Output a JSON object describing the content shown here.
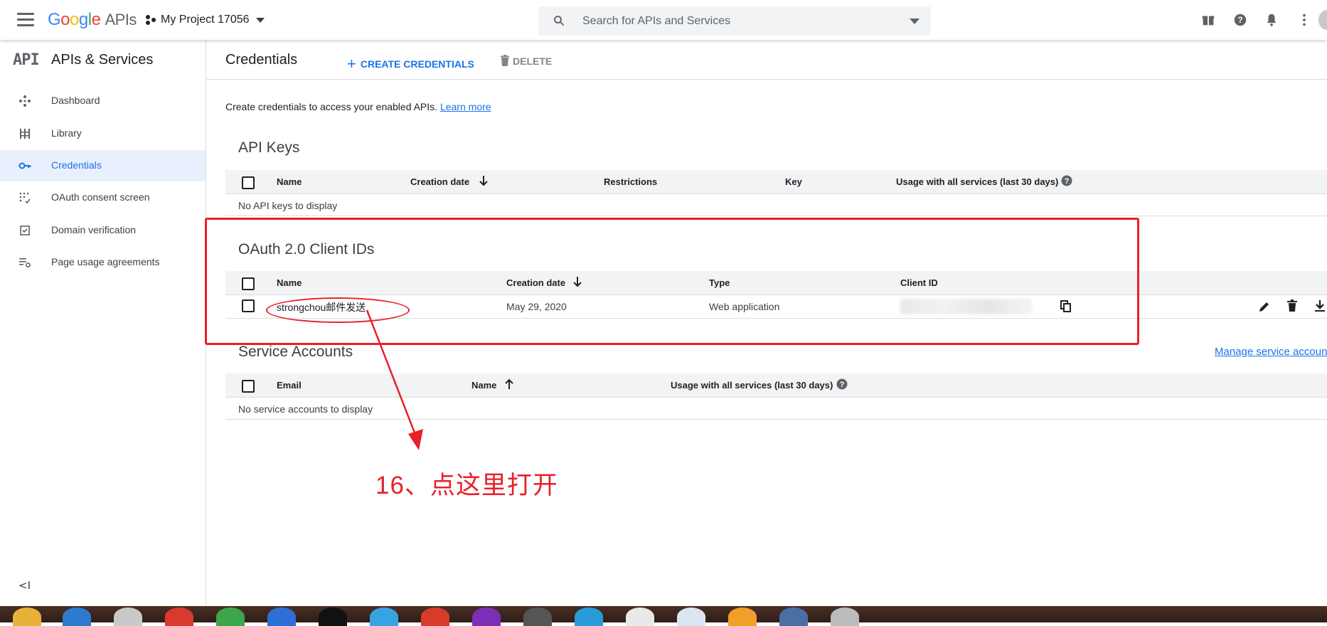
{
  "topbar": {
    "logo_word": "Google",
    "logo_suffix": "APIs",
    "project_name": "My Project 17056",
    "search_placeholder": "Search for APIs and Services"
  },
  "sidebar": {
    "title": "APIs & Services",
    "head_icon_text": "API",
    "items": [
      {
        "label": "Dashboard",
        "icon": "dashboard-icon"
      },
      {
        "label": "Library",
        "icon": "library-icon"
      },
      {
        "label": "Credentials",
        "icon": "key-icon",
        "active": true
      },
      {
        "label": "OAuth consent screen",
        "icon": "consent-icon"
      },
      {
        "label": "Domain verification",
        "icon": "checkbox-doc-icon"
      },
      {
        "label": "Page usage agreements",
        "icon": "settings-list-icon"
      }
    ],
    "collapse_label": "<I"
  },
  "main": {
    "title": "Credentials",
    "create_label": "CREATE CREDENTIALS",
    "delete_label": "DELETE",
    "intro_text": "Create credentials to access your enabled APIs.",
    "learn_more": "Learn more",
    "api_keys": {
      "title": "API Keys",
      "columns": [
        "Name",
        "Creation date",
        "Restrictions",
        "Key",
        "Usage with all services (last 30 days)"
      ],
      "empty": "No API keys to display"
    },
    "oauth": {
      "title": "OAuth 2.0 Client IDs",
      "columns": [
        "Name",
        "Creation date",
        "Type",
        "Client ID"
      ],
      "rows": [
        {
          "name": "strongchou邮件发送",
          "date": "May 29, 2020",
          "type": "Web application"
        }
      ]
    },
    "service_accounts": {
      "title": "Service Accounts",
      "manage_link": "Manage service accounts",
      "columns": [
        "Email",
        "Name",
        "Usage with all services (last 30 days)"
      ],
      "empty": "No service accounts to display"
    }
  },
  "annotation": {
    "text": "16、点这里打开",
    "color": "#e8202a"
  },
  "colors": {
    "accent": "#1a73e8",
    "active_bg": "#e8f0fe",
    "header_bg": "#f1f3f4"
  }
}
